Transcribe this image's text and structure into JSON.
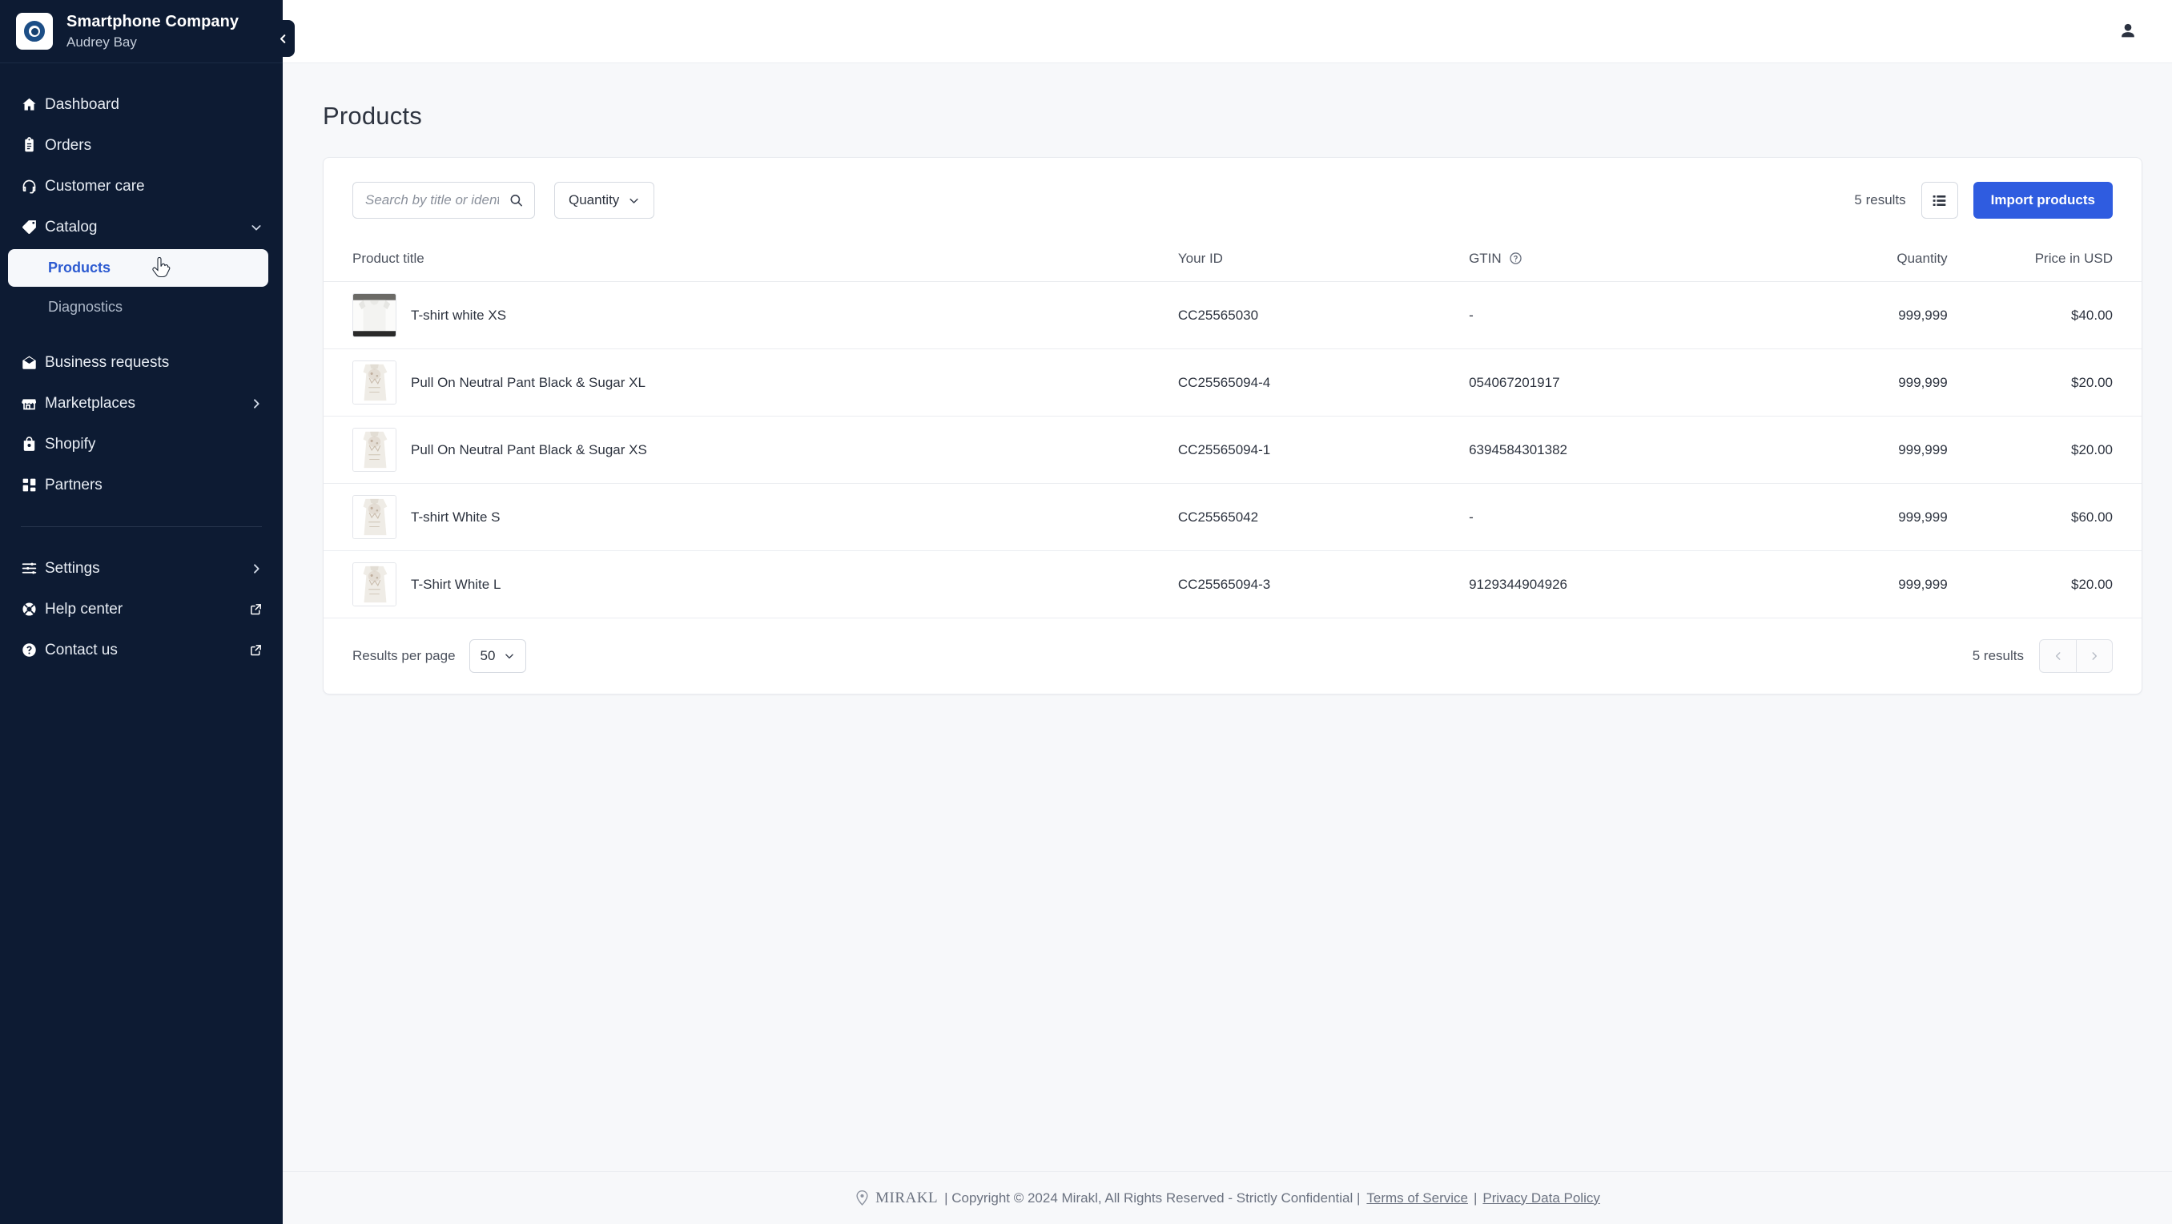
{
  "sidebar": {
    "company": "Smartphone Company",
    "user": "Audrey Bay",
    "logo_icon": "target-circle-logo",
    "collapse_icon": "chevron-left-icon",
    "items": [
      {
        "label": "Dashboard",
        "icon": "home-icon"
      },
      {
        "label": "Orders",
        "icon": "clipboard-icon"
      },
      {
        "label": "Customer care",
        "icon": "headset-icon"
      },
      {
        "label": "Catalog",
        "icon": "tag-icon",
        "chevron": "chevron-down-icon"
      }
    ],
    "sub_items": [
      {
        "label": "Products",
        "active": true
      },
      {
        "label": "Diagnostics",
        "active": false
      }
    ],
    "items2": [
      {
        "label": "Business requests",
        "icon": "envelope-open-icon"
      },
      {
        "label": "Marketplaces",
        "icon": "storefront-icon",
        "chevron": "chevron-right-icon"
      },
      {
        "label": "Shopify",
        "icon": "shopping-bag-icon"
      },
      {
        "label": "Partners",
        "icon": "grid-blocks-icon"
      }
    ],
    "items3": [
      {
        "label": "Settings",
        "icon": "sliders-icon",
        "chevron": "chevron-right-icon"
      },
      {
        "label": "Help center",
        "icon": "lifebuoy-icon",
        "ext": "external-link-icon"
      },
      {
        "label": "Contact us",
        "icon": "question-circle-icon",
        "ext": "external-link-icon"
      }
    ]
  },
  "topbar": {
    "account_icon": "user-account-icon"
  },
  "page": {
    "title": "Products"
  },
  "toolbar": {
    "search_placeholder": "Search by title or identifier",
    "search_value": "",
    "search_icon": "search-icon",
    "filter_label": "Quantity",
    "filter_chevron": "chevron-down-icon",
    "results_count": "5 results",
    "view_icon": "list-view-icon",
    "import_label": "Import products",
    "accent_color": "#2f5ce0"
  },
  "table": {
    "headers": {
      "title": "Product title",
      "your_id": "Your ID",
      "gtin": "GTIN",
      "gtin_help_icon": "help-circle-icon",
      "quantity": "Quantity",
      "price": "Price in USD"
    },
    "rows": [
      {
        "thumb": "tshirt-white-photo",
        "title": "T-shirt white XS",
        "your_id": "CC25565030",
        "gtin": "-",
        "quantity": "999,999",
        "price": "$40.00"
      },
      {
        "thumb": "pant-beige-photo",
        "title": "Pull On Neutral Pant Black & Sugar XL",
        "your_id": "CC25565094-4",
        "gtin": "054067201917",
        "quantity": "999,999",
        "price": "$20.00"
      },
      {
        "thumb": "pant-beige-photo",
        "title": "Pull On Neutral Pant Black & Sugar XS",
        "your_id": "CC25565094-1",
        "gtin": "6394584301382",
        "quantity": "999,999",
        "price": "$20.00"
      },
      {
        "thumb": "pant-beige-photo",
        "title": "T-shirt White S",
        "your_id": "CC25565042",
        "gtin": "-",
        "quantity": "999,999",
        "price": "$60.00"
      },
      {
        "thumb": "pant-beige-photo",
        "title": "T-Shirt White L",
        "your_id": "CC25565094-3",
        "gtin": "9129344904926",
        "quantity": "999,999",
        "price": "$20.00"
      }
    ]
  },
  "pagination": {
    "results_per_page_label": "Results per page",
    "results_per_page_value": "50",
    "select_chevron": "chevron-down-icon",
    "results_count": "5 results",
    "prev_icon": "chevron-left-icon",
    "next_icon": "chevron-right-icon"
  },
  "footer": {
    "logo_text": "MIRAKL",
    "logo_icon": "mirakl-pin-logo",
    "copyright": "| Copyright © 2024 Mirakl, All Rights Reserved - Strictly Confidential  |",
    "terms_link": "Terms of Service",
    "separator": "|",
    "privacy_link": "Privacy Data Policy"
  }
}
